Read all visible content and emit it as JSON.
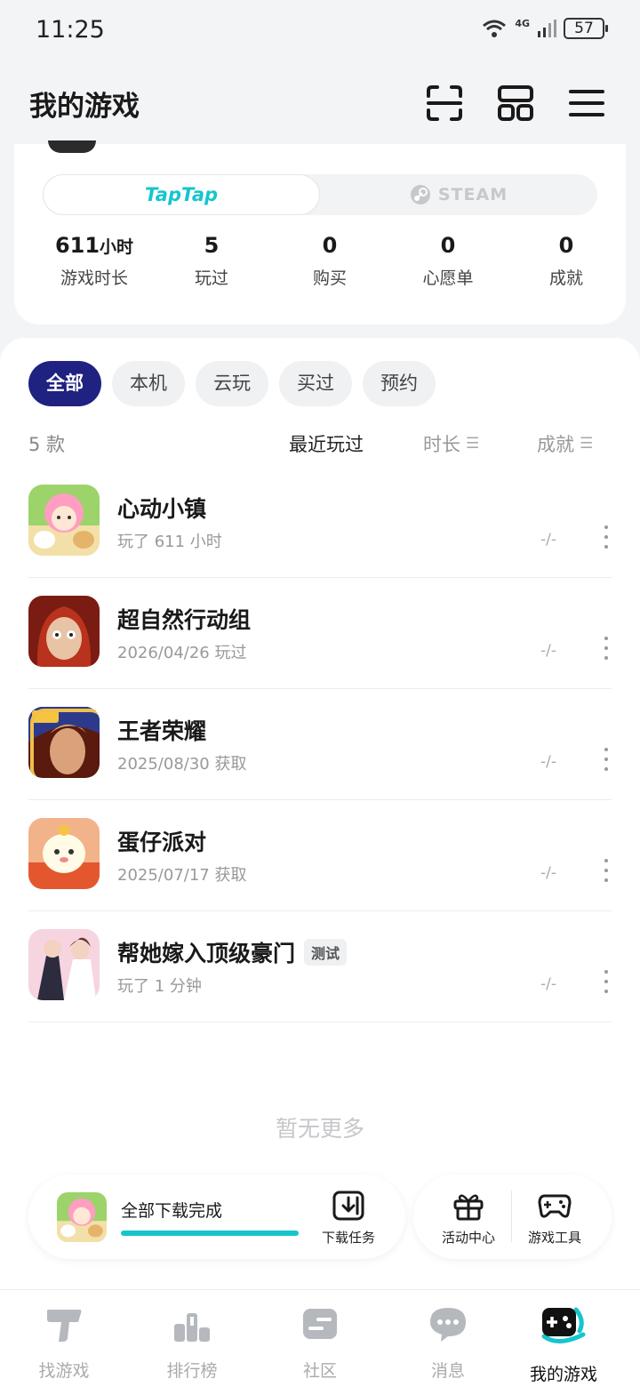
{
  "status": {
    "time": "11:25",
    "network": "4G",
    "battery": "57"
  },
  "header": {
    "title": "我的游戏"
  },
  "platforms": {
    "taptap": "TapTap",
    "steam": "STEAM"
  },
  "stats": [
    {
      "value": "611",
      "unit": "小时",
      "label": "游戏时长"
    },
    {
      "value": "5",
      "unit": "",
      "label": "玩过"
    },
    {
      "value": "0",
      "unit": "",
      "label": "购买"
    },
    {
      "value": "0",
      "unit": "",
      "label": "心愿单"
    },
    {
      "value": "0",
      "unit": "",
      "label": "成就"
    }
  ],
  "filters": [
    "全部",
    "本机",
    "云玩",
    "买过",
    "预约"
  ],
  "list": {
    "count": "5 款",
    "sort_recent": "最近玩过",
    "sort_duration": "时长",
    "sort_achievement": "成就"
  },
  "games": [
    {
      "name": "心动小镇",
      "sub": "玩了 611 小时",
      "achievement": "-/-",
      "tag": ""
    },
    {
      "name": "超自然行动组",
      "sub": "2026/04/26 玩过",
      "achievement": "-/-",
      "tag": ""
    },
    {
      "name": "王者荣耀",
      "sub": "2025/08/30 获取",
      "achievement": "-/-",
      "tag": ""
    },
    {
      "name": "蛋仔派对",
      "sub": "2025/07/17 获取",
      "achievement": "-/-",
      "tag": ""
    },
    {
      "name": "帮她嫁入顶级豪门",
      "sub": "玩了 1 分钟",
      "achievement": "-/-",
      "tag": "测试"
    }
  ],
  "no_more": "暂无更多",
  "download": {
    "status": "全部下载完成",
    "progress": 1.0,
    "tasks_label": "下载任务"
  },
  "tools": {
    "activity": "活动中心",
    "game_tools": "游戏工具"
  },
  "nav": [
    "找游戏",
    "排行榜",
    "社区",
    "消息",
    "我的游戏"
  ],
  "colors": {
    "accent": "#15c5ce",
    "chip_active": "#1f2280"
  }
}
